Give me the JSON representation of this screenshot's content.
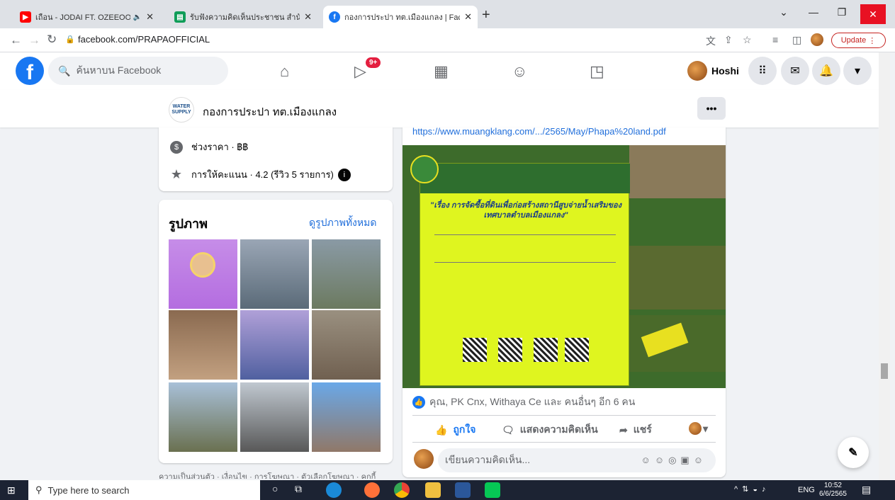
{
  "browser": {
    "tabs": [
      {
        "title": "เถือน - JODAI FT. OZEEOOS [(",
        "icon": "youtube-icon",
        "color": "#ff0000"
      },
      {
        "title": "รับฟังความคิดเห็นประชาชน สำนักงาน",
        "icon": "green-doc-icon",
        "color": "#0f9d58"
      },
      {
        "title": "กองการประปา ทต.เมืองแกลง | Facebo",
        "icon": "facebook-icon",
        "color": "#1877f2"
      }
    ],
    "url": "facebook.com/PRAPAOFFICIAL",
    "update_label": "Update"
  },
  "facebook": {
    "search_placeholder": "ค้นหาบน Facebook",
    "notif_badge": "9+",
    "profile_name": "Hoshi"
  },
  "page": {
    "name": "กองการประปา ทต.เมืองแกลง",
    "logo_text": "WATER SUPPLY",
    "price_range": "ช่วงราคา · ฿฿",
    "rating": "การให้คะแนน · 4.2 (รีวิว 5 รายการ)"
  },
  "photos": {
    "title": "รูปภาพ",
    "see_all": "ดูรูปภาพทั้งหมด"
  },
  "footer": "ความเป็นส่วนตัว · เงื่อนไข · การโฆษณา · ตัวเลือกโฆษณา · คุกกี้",
  "post": {
    "link": "https://www.muangklang.com/.../2565/May/Phapa%20land.pdf",
    "reactions": "คุณ, PK Cnx, Withaya Ce และ คนอื่นๆ อีก 6 คน",
    "like": "ถูกใจ",
    "comment": "แสดงความคิดเห็น",
    "share": "แชร์",
    "comment_placeholder": "เขียนความคิดเห็น...",
    "img_title": "\"เรื่อง การจัดซื้อที่ดินเพื่อก่อสร้างสถานีสูบจ่ายน้ำเสริมของเทศบาลตำบลเมืองแกลง\""
  },
  "taskbar": {
    "search": "Type here to search",
    "lang": "ENG",
    "time": "10:52",
    "date": "6/6/2565"
  }
}
